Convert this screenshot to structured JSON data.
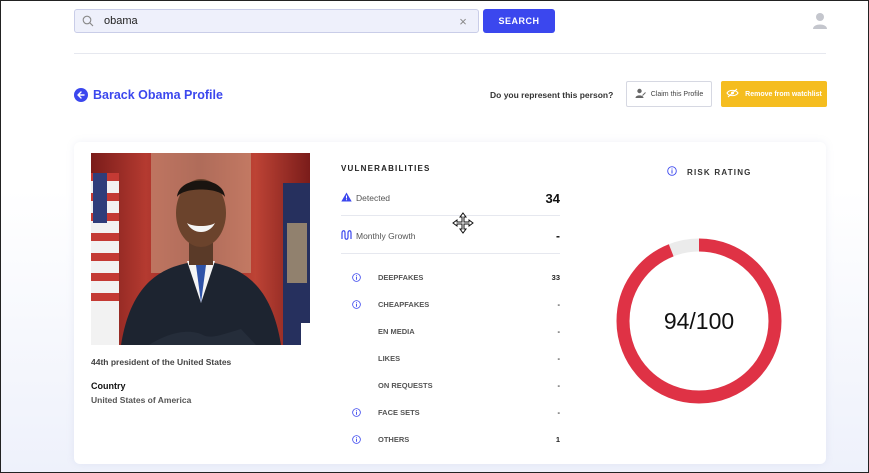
{
  "search": {
    "value": "obama",
    "button_label": "SEARCH"
  },
  "profile": {
    "title": "Barack Obama Profile",
    "represent_question": "Do you represent this person?",
    "claim_label": "Claim this Profile",
    "remove_label": "Remove from watchlist",
    "bio": "44th president of the United States",
    "country_label": "Country",
    "country_value": "United States of America"
  },
  "vulnerabilities": {
    "title": "VULNERABILITIES",
    "detected_label": "Detected",
    "detected_value": "34",
    "growth_label": "Monthly Growth",
    "growth_value": "-",
    "categories": [
      {
        "name": "DEEPFAKES",
        "count": "33",
        "icon": true
      },
      {
        "name": "CHEAPFAKES",
        "count": "-",
        "icon": true
      },
      {
        "name": "EN MEDIA",
        "count": "-",
        "icon": false
      },
      {
        "name": "LIKES",
        "count": "-",
        "icon": false
      },
      {
        "name": "ON REQUESTS",
        "count": "-",
        "icon": false
      },
      {
        "name": "FACE SETS",
        "count": "-",
        "icon": true
      },
      {
        "name": "OTHERS",
        "count": "1",
        "icon": true
      }
    ]
  },
  "risk": {
    "title": "RISK RATING",
    "score_text": "94/100",
    "score": 94,
    "max": 100
  },
  "colors": {
    "accent": "#3b47ee",
    "warning": "#f5bd1f",
    "risk": "#df3245",
    "risk_track": "#ebebeb"
  }
}
